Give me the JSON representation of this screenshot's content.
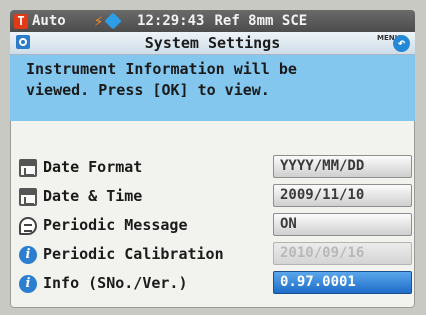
{
  "status_bar": {
    "mode": "Auto",
    "mode_icon": "T",
    "time": "12:29:43",
    "ref": "Ref 8mm SCE"
  },
  "title_bar": {
    "title": "System Settings",
    "menu_label": "MENU"
  },
  "message": "Instrument Information will be\nviewed. Press [OK] to view.",
  "settings": [
    {
      "label": "Date Format",
      "value": "YYYY/MM/DD",
      "icon": "calendar-icon"
    },
    {
      "label": "Date & Time",
      "value": "2009/11/10",
      "icon": "calendar-icon"
    },
    {
      "label": "Periodic Message",
      "value": "ON",
      "icon": "message-bubble-icon"
    },
    {
      "label": "Periodic Calibration",
      "value": "2010/09/16",
      "icon": "info-icon",
      "disabled": true
    },
    {
      "label": "Info (SNo./Ver.)",
      "value": "0.97.0001",
      "icon": "info-icon",
      "selected": true
    }
  ],
  "colors": {
    "accent": "#1e6cc8",
    "message_bg": "#84c7ee",
    "status_bg": "#4c4c4c",
    "mode_icon": "#e13a17"
  }
}
